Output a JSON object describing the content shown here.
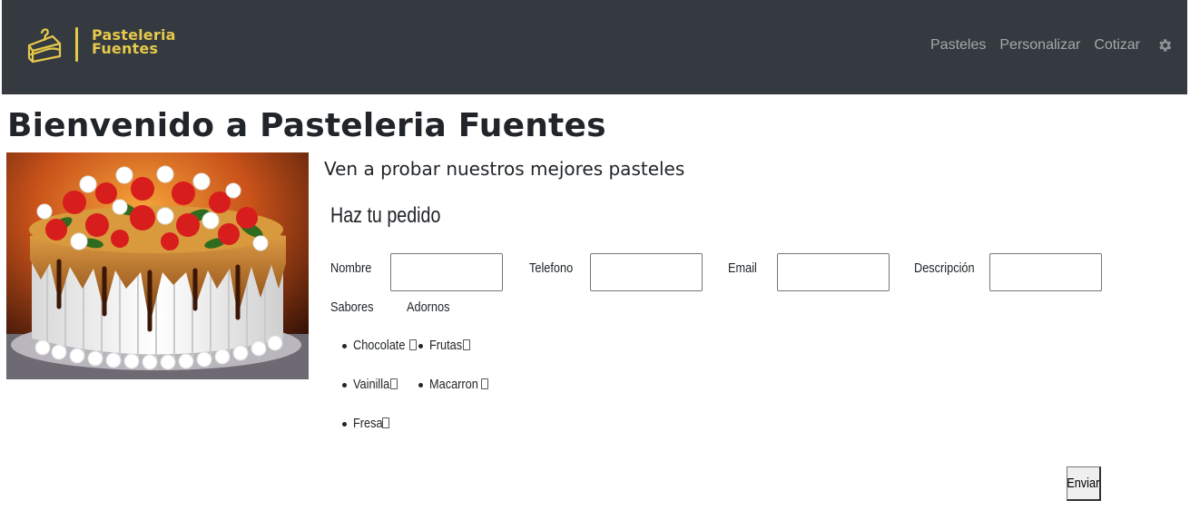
{
  "navbar": {
    "brand_line1": "Pasteleria",
    "brand_line2": "Fuentes",
    "brand_color": "#e6c84a",
    "background": "#343a40",
    "logo_icon": "cake-slice-icon",
    "links": [
      {
        "label": "Pasteles"
      },
      {
        "label": "Personalizar"
      },
      {
        "label": "Cotizar"
      }
    ],
    "settings_icon": "gear-icon"
  },
  "main": {
    "title": "Bienvenido a Pasteleria Fuentes",
    "tagline": "Ven a probar nuestros mejores pasteles",
    "image": "strawberry-cake-photo"
  },
  "form": {
    "title": "Haz tu pedido",
    "fields": {
      "nombre": {
        "label": "Nombre",
        "value": ""
      },
      "telefono": {
        "label": "Telefono",
        "value": ""
      },
      "email": {
        "label": "Email",
        "value": ""
      },
      "descripcion": {
        "label": "Descripción",
        "value": ""
      }
    },
    "sabores": {
      "label": "Sabores",
      "options": [
        {
          "label": "Chocolate",
          "checked": false
        },
        {
          "label": "Vainilla",
          "checked": false
        },
        {
          "label": "Fresa",
          "checked": false
        }
      ]
    },
    "adornos": {
      "label": "Adornos",
      "options": [
        {
          "label": "Frutas",
          "checked": false
        },
        {
          "label": "Macarron",
          "checked": false
        }
      ]
    },
    "submit_label": "Enviar"
  }
}
